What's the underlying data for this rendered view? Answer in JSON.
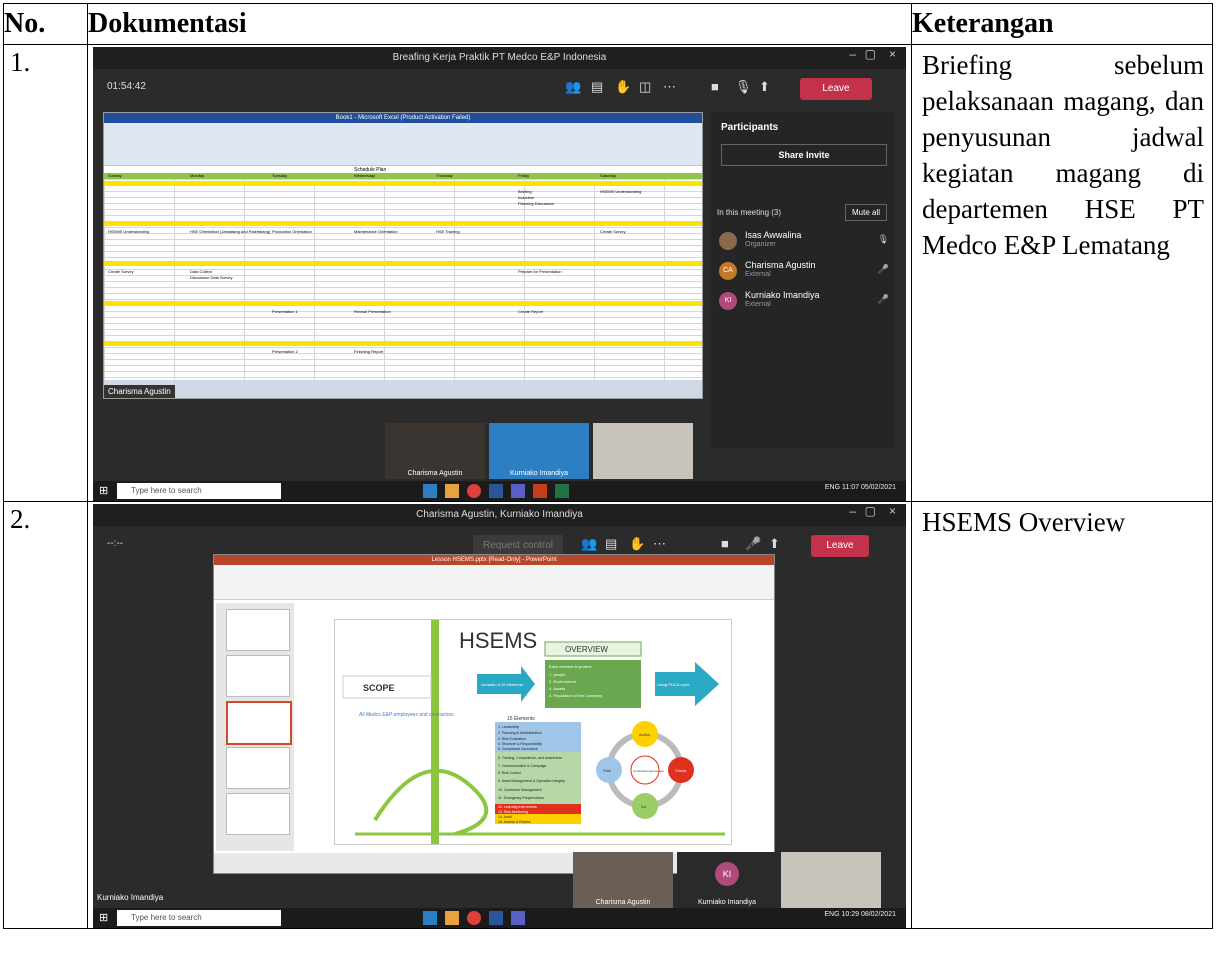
{
  "table": {
    "headers": [
      "No.",
      "Dokumentasi",
      "Keterangan"
    ],
    "rows": [
      {
        "no": "1.",
        "desc": "Briefing sebelum pelaksanaan magang, dan penyusunan jadwal kegiatan magang di departemen HSE PT Medco E&P Lematang",
        "screenshot": {
          "title": "Breafing Kerja Praktik PT Medco E&P Indonesia",
          "timer": "01:54:42",
          "leave_label": "Leave",
          "excel_title": "Book1 - Microsoft Excel (Product Activation Failed)",
          "schedule_title": "Schedule Plan",
          "days": [
            "Sunday",
            "Monday",
            "Tuesday",
            "Wednesday",
            "Thursday",
            "Friday",
            "Saturday"
          ],
          "cells": [
            "Briefing",
            "Induction",
            "Planning Discussion",
            "HSEMS Understanding",
            "HSE Orientation (Jamaitang and Palembang)",
            "Production Orientation",
            "Maintenance Orientation",
            "HSE Training",
            "Create Survey",
            "Data Collect",
            "Discussion Data Survey",
            "Prepare for Presentation",
            "Presentation 1",
            "Revisal Presentation",
            "Create Report",
            "Presentation 2",
            "Finishing Report"
          ],
          "presenter": "Charisma Agustin",
          "panel": {
            "title": "Participants",
            "share": "Share Invite",
            "in_meeting": "In this meeting (3)",
            "mute_all": "Mute all",
            "people": [
              {
                "name": "Isas Awwalina",
                "role": "Organizer",
                "initials": "",
                "color": "#8a6a4a"
              },
              {
                "name": "Charisma Agustin",
                "role": "External",
                "initials": "CA",
                "color": "#c27a2a"
              },
              {
                "name": "Kurniako Imandiya",
                "role": "External",
                "initials": "KI",
                "color": "#b04a7a"
              }
            ]
          },
          "video_labels": [
            "Charisma Agustin",
            "Kurniako Imandiya",
            ""
          ],
          "search_placeholder": "Type here to search",
          "tray_time": "11:07",
          "tray_date": "05/02/2021",
          "tray_lang": "ENG"
        }
      },
      {
        "no": "2.",
        "desc": "HSEMS Overview",
        "screenshot": {
          "title": "Charisma Agustin, Kurniako Imandiya",
          "timer": "--:--",
          "request_control": "Request control",
          "leave_label": "Leave",
          "ppt_title": "Lesson HSEMS.pptx [Read-Only] - PowerPoint",
          "slide": {
            "heading": "HSEMS",
            "overview": "OVERVIEW",
            "scope": "SCOPE",
            "scope_text": "All Medco E&P employees and contractors",
            "arrow1": "consists of 15 elements",
            "arrow2_items": [
              "Each element to protect:",
              "1. people",
              "2. Environment",
              "3. Assets",
              "4. Reputation of the Company"
            ],
            "arrow3": "Using PDCA cycle",
            "elements_title": "15 Elements",
            "elements_blue": [
              "1. Leadership",
              "2. Planning & Administration",
              "3. Risk Evaluation",
              "4. Structure & Responsibility",
              "5. Compliance Assurance"
            ],
            "elements_green": [
              "6. Training, Competence, and Awareness",
              "7. Communication & Campaign",
              "8. Risk Control",
              "9. Asset Management & Operation Integrity",
              "10. Contractor Management",
              "11. Emergency Preparedness"
            ],
            "elements_red": [
              "12. Learning from events",
              "13. Risk Monitoring"
            ],
            "elements_yellow": [
              "14. Audit",
              "15. Assess & Review"
            ],
            "cycle": [
              "Action",
              "Check",
              "Do",
              "Plan"
            ],
            "cycle_center": "Continual Improvement"
          },
          "presenter": "Kurniako Imandiya",
          "video_labels": [
            "Charisma Agustin",
            "Kurniako Imandiya",
            ""
          ],
          "ki_initials": "KI",
          "search_placeholder": "Type here to search",
          "tray_time": "10:29",
          "tray_date": "08/02/2021",
          "tray_lang": "ENG"
        }
      }
    ]
  }
}
